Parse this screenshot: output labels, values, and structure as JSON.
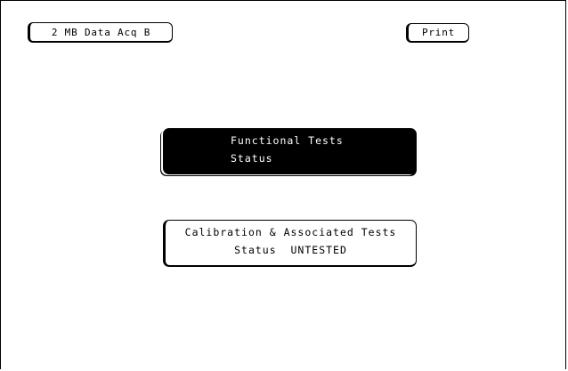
{
  "header": {
    "module_label": "2 MB Data Acq B",
    "print_label": "Print"
  },
  "functional_tests": {
    "title": "Functional Tests",
    "status_label": "Status",
    "status_value": ""
  },
  "calibration_tests": {
    "title": "Calibration & Associated Tests",
    "status_line": "Status  UNTESTED"
  }
}
